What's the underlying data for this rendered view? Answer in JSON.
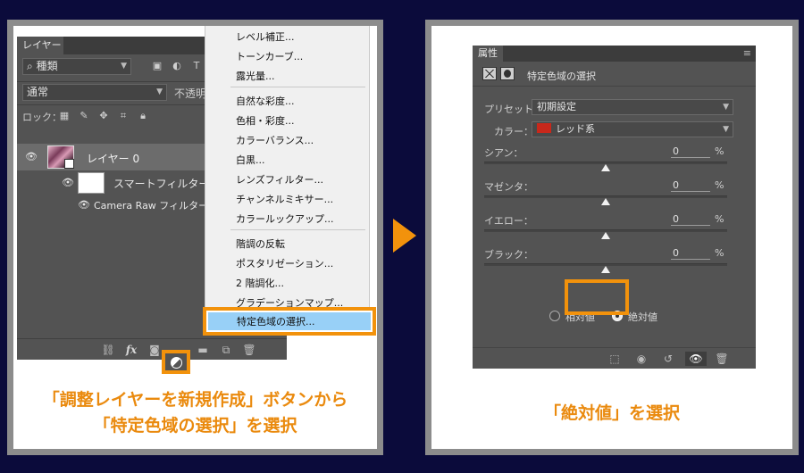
{
  "left": {
    "layers_panel": {
      "tab": "レイヤー",
      "filter": {
        "search_glyph": "⌕",
        "value": "種類"
      },
      "blend_mode": "通常",
      "opacity_label": "不透明度",
      "lock_label": "ロック：",
      "layer_name": "レイヤー 0",
      "smart_filter_label": "スマートフィルター",
      "camera_raw_label": "Camera Raw フィルター",
      "footer": {
        "fx_label": "fx"
      }
    },
    "menu": {
      "items_group1": [
        "レベル補正...",
        "トーンカーブ...",
        "露光量..."
      ],
      "items_group2": [
        "自然な彩度...",
        "色相・彩度...",
        "カラーバランス...",
        "白黒...",
        "レンズフィルター...",
        "チャンネルミキサー...",
        "カラールックアップ..."
      ],
      "items_group3": [
        "階調の反転",
        "ポスタリゼーション...",
        "2 階調化...",
        "グラデーションマップ..."
      ],
      "highlighted": "特定色域の選択..."
    },
    "caption": {
      "line1": "「調整レイヤーを新規作成」ボタンから",
      "line2": "「特定色域の選択」を選択"
    }
  },
  "right": {
    "properties_panel": {
      "tab": "属性",
      "title": "特定色域の選択",
      "preset_label": "プリセット：",
      "preset_value": "初期設定",
      "color_label": "カラー：",
      "color_value": "レッド系",
      "color_swatch": "#c8281b",
      "sliders": [
        {
          "label": "シアン：",
          "value": "0",
          "unit": "%",
          "position": 0.5
        },
        {
          "label": "マゼンタ：",
          "value": "0",
          "unit": "%",
          "position": 0.5
        },
        {
          "label": "イエロー：",
          "value": "0",
          "unit": "%",
          "position": 0.5
        },
        {
          "label": "ブラック：",
          "value": "0",
          "unit": "%",
          "position": 0.5
        }
      ],
      "relative_label": "相対値",
      "absolute_label": "絶対値",
      "selected_method": "絶対値"
    },
    "caption": "「絶対値」を選択"
  },
  "colors": {
    "accent": "#f2920c",
    "caption_text": "#ea8a0e",
    "background": "#0b0b3b",
    "panel": "#535353",
    "menu_highlight": "#98d0f7"
  }
}
